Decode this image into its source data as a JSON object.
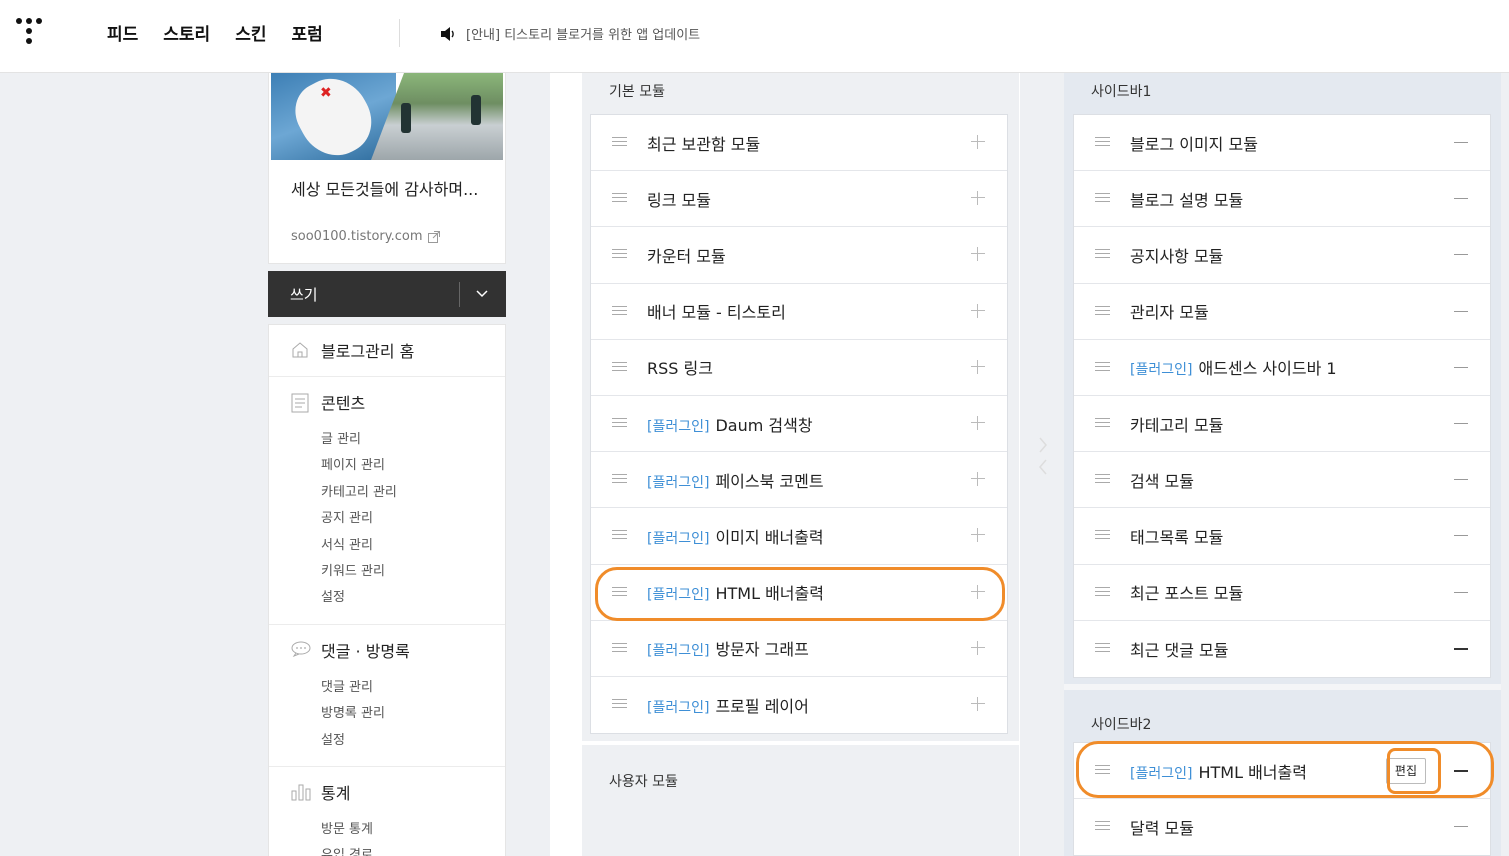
{
  "topbar": {
    "nav": [
      "피드",
      "스토리",
      "스킨",
      "포럼"
    ],
    "notice": "[안내] 티스토리 블로거를 위한 앱 업데이트"
  },
  "blog": {
    "title": "세상 모든것들에 감사하며...",
    "url": "soo0100.tistory.com"
  },
  "write": {
    "label": "쓰기"
  },
  "menu": {
    "home": "블로그관리 홈",
    "content": {
      "title": "콘텐츠",
      "items": [
        "글 관리",
        "페이지 관리",
        "카테고리 관리",
        "공지 관리",
        "서식 관리",
        "키워드 관리",
        "설정"
      ]
    },
    "comments": {
      "title": "댓글 · 방명록",
      "items": [
        "댓글 관리",
        "방명록 관리",
        "설정"
      ]
    },
    "stats": {
      "title": "통계",
      "items": [
        "방문 통계",
        "유입 경로"
      ]
    }
  },
  "basic": {
    "title": "기본 모듈",
    "plugin_tag": "[플러그인]",
    "items": [
      {
        "label": "최근 보관함 모듈"
      },
      {
        "label": "링크 모듈"
      },
      {
        "label": "카운터 모듈"
      },
      {
        "label": "배너 모듈 - 티스토리"
      },
      {
        "label": "RSS 링크"
      },
      {
        "label": "Daum 검색창"
      },
      {
        "label": "페이스북 코멘트"
      },
      {
        "label": "이미지 배너출력"
      },
      {
        "label": "HTML 배너출력"
      },
      {
        "label": "방문자 그래프"
      },
      {
        "label": "프로필 레이어"
      }
    ]
  },
  "user_modules": {
    "title": "사용자 모듈"
  },
  "sidebar1": {
    "title": "사이드바1",
    "items": [
      {
        "label": "블로그 이미지 모듈"
      },
      {
        "label": "블로그 설명 모듈"
      },
      {
        "label": "공지사항 모듈"
      },
      {
        "label": "관리자 모듈"
      },
      {
        "label": "애드센스 사이드바 1"
      },
      {
        "label": "카테고리 모듈"
      },
      {
        "label": "검색 모듈"
      },
      {
        "label": "태그목록 모듈"
      },
      {
        "label": "최근 포스트 모듈"
      },
      {
        "label": "최근 댓글 모듈"
      }
    ]
  },
  "sidebar2": {
    "title": "사이드바2",
    "edit_label": "편집",
    "items": [
      {
        "label": "HTML 배너출력"
      },
      {
        "label": "달력 모듈"
      }
    ]
  },
  "colors": {
    "highlight": "#f08c2a",
    "plugin": "#3e8fd6"
  }
}
